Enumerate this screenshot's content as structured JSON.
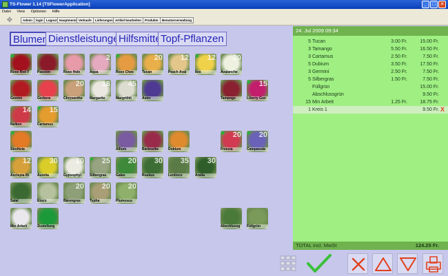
{
  "window": {
    "title": "TS-Flower 1.14 [TSFlowerApplication]",
    "minimize": "_",
    "maximize": "□",
    "close": "✕"
  },
  "menu": [
    "Datei",
    "View",
    "Optionen",
    "Hilfe"
  ],
  "toolbar": {
    "icon": "expand-icon",
    "buttons": [
      "Admin",
      "login",
      "Logout",
      "Hauptmenü",
      "Verkaufe",
      "Lieferungen",
      "Artikel bearbeiten",
      "Produkte",
      "Benutzerverwaltung"
    ]
  },
  "categories": [
    "Blumen",
    "Dienstleistungen",
    "Hilfsmittel",
    "Topf-Pflanzen"
  ],
  "products": [
    {
      "name": "Rose Red F",
      "num": "",
      "color": "#a3101e",
      "dot": true
    },
    {
      "name": "Passion",
      "num": "",
      "color": "#8a1a2a",
      "dot": false
    },
    {
      "name": "Rose Hele",
      "num": "",
      "color": "#e79aa8",
      "dot": false
    },
    {
      "name": "Aqua",
      "num": "2",
      "color": "#e5a9c0",
      "dot": false
    },
    {
      "name": "Rose Chee",
      "num": "",
      "color": "#e49b42",
      "dot": true
    },
    {
      "name": "Tucan",
      "num": "20",
      "color": "#e8af4a",
      "dot": false
    },
    {
      "name": "Peach Aval",
      "num": "12",
      "color": "#e3c78a",
      "dot": false
    },
    {
      "name": "Ibis",
      "num": "12",
      "color": "#f0d24a",
      "dot": true
    },
    {
      "name": "Avalanche",
      "num": "20",
      "color": "#eef0e0",
      "dot": false
    },
    {
      "name": "Gemini",
      "num": "",
      "color": "#b21a22",
      "dot": false
    },
    {
      "name": "Gerbera",
      "num": "",
      "color": "#e8414d",
      "dot": false
    },
    {
      "name": "Chrysanthe",
      "num": "20",
      "color": "#c9a07a",
      "dot": false
    },
    {
      "name": "Margarite",
      "num": "18",
      "color": "#eae8e0",
      "dot": false
    },
    {
      "name": "Margrithli",
      "num": "45",
      "color": "#dcdcd0",
      "dot": false
    },
    {
      "name": "Aster",
      "num": "",
      "color": "#4e3a92",
      "dot": false
    },
    {
      "name": "Tamango",
      "num": "",
      "color": "#8a2030",
      "dot": false
    },
    {
      "name": "Liberty Gux",
      "num": "15",
      "color": "#c31e6e",
      "dot": true
    },
    {
      "name": "Nelken",
      "num": "14",
      "color": "#cf3a48",
      "dot": false
    },
    {
      "name": "Cartamus",
      "num": "15",
      "color": "#e59c2e",
      "dot": true
    },
    {
      "name": "Strelitzia",
      "num": "",
      "color": "#e57a26",
      "dot": true
    },
    {
      "name": "Allium",
      "num": "",
      "color": "#7a5aa0",
      "dot": false
    },
    {
      "name": "Barbnelke",
      "num": "",
      "color": "#9a2a4a",
      "dot": false
    },
    {
      "name": "Dubium",
      "num": "",
      "color": "#e08a2e",
      "dot": false
    },
    {
      "name": "Freesia",
      "num": "20",
      "color": "#d23a52",
      "dot": true
    },
    {
      "name": "Campanula",
      "num": "20",
      "color": "#6a62b8",
      "dot": true
    },
    {
      "name": "Asclepia Bl",
      "num": "12",
      "color": "#d6a03a",
      "dot": true
    },
    {
      "name": "Aurelia",
      "num": "30",
      "color": "#dacd2a",
      "dot": false
    },
    {
      "name": "Gypsophyl",
      "num": "20",
      "color": "#ecebe2",
      "dot": false
    },
    {
      "name": "Silbergras",
      "num": "25",
      "color": "#97a482",
      "dot": true
    },
    {
      "name": "Galax",
      "num": "20",
      "color": "#3c8a3a",
      "dot": false
    },
    {
      "name": "Ruskus",
      "num": "30",
      "color": "#3c6d34",
      "dot": false
    },
    {
      "name": "Lentisco",
      "num": "35",
      "color": "#5a7a46",
      "dot": false
    },
    {
      "name": "Aralia",
      "num": "30",
      "color": "#2f5e2a",
      "dot": false
    },
    {
      "name": "Salal",
      "num": "",
      "color": "#3a6a32",
      "dot": false
    },
    {
      "name": "Eluco",
      "num": "",
      "color": "#b6c19e",
      "dot": false
    },
    {
      "name": "Bärengras",
      "num": "20",
      "color": "#8ea078",
      "dot": false
    },
    {
      "name": "Typha",
      "num": "20",
      "color": "#a99e76",
      "dot": false
    },
    {
      "name": "Plumosus",
      "num": "20",
      "color": "#8fb06a",
      "dot": false
    },
    {
      "name": "Min Arbeit",
      "num": "",
      "color": "#eae8ec",
      "dot": false
    },
    {
      "name": "Zustellung",
      "num": "",
      "color": "#1c9a3a",
      "dot": false
    },
    {
      "name": "Abschlussg",
      "num": "",
      "color": "#4a7a3a",
      "dot": false
    },
    {
      "name": "Füllgrün",
      "num": "",
      "color": "#7a9a5a",
      "dot": false
    }
  ],
  "receipt": {
    "date": "24. Jul 2009 09:34",
    "lines": [
      {
        "qty": "5",
        "name": "Tucan",
        "price": "3.00 Fr.",
        "total": "15.00 Fr."
      },
      {
        "qty": "3",
        "name": "Tamango",
        "price": "5.50 Fr.",
        "total": "16.50 Fr."
      },
      {
        "qty": "3",
        "name": "Cartamus",
        "price": "2.50 Fr.",
        "total": "7.50 Fr."
      },
      {
        "qty": "5",
        "name": "Dubium",
        "price": "3.50 Fr.",
        "total": "17.50 Fr."
      },
      {
        "qty": "3",
        "name": "Germini",
        "price": "2.50 Fr.",
        "total": "7.50 Fr."
      },
      {
        "qty": "5",
        "name": "Silbergras",
        "price": "1.50 Fr.",
        "total": "7.50 Fr."
      },
      {
        "qty": "",
        "name": "Füllgrün",
        "price": "",
        "total": "15.00 Fr."
      },
      {
        "qty": "",
        "name": "Abschlussgrün",
        "price": "",
        "total": "9.50 Fr."
      },
      {
        "qty": "15",
        "name": "Min Arbeit",
        "price": "1.25 Fr.",
        "total": "18.75 Fr."
      },
      {
        "qty": "1",
        "name": "Kreis 1",
        "price": "",
        "total": "9.50 Fr.",
        "delete": "X"
      }
    ],
    "total_label": "TOTAL incl. MwSt",
    "total_value": "124.25 Fr."
  },
  "actions": [
    "grid-icon",
    "check-icon",
    "cancel-x-icon",
    "triangle-up-icon",
    "triangle-down-icon",
    "print-icon"
  ],
  "colors": {
    "accent": "#2424b8",
    "receipt": "#9fef82",
    "confirm": "#39c039",
    "danger": "#e0401c"
  }
}
